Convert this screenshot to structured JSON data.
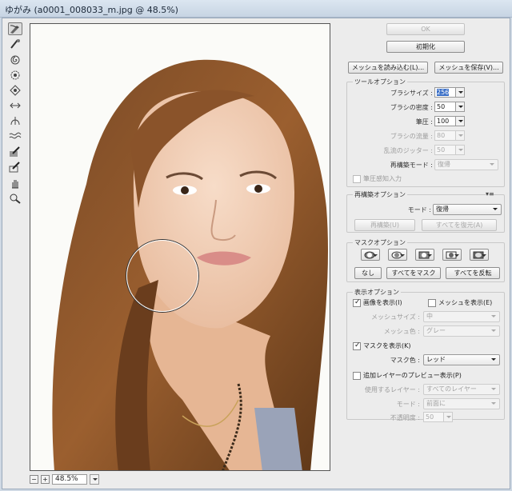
{
  "window": {
    "title": "ゆがみ (a0001_008033_m.jpg @ 48.5%)"
  },
  "status": {
    "zoom": "48.5%"
  },
  "buttons": {
    "ok": "OK",
    "reset": "初期化",
    "load_mesh": "メッシュを読み込む(L)...",
    "save_mesh": "メッシュを保存(V)..."
  },
  "tool_options": {
    "title": "ツールオプション",
    "brush_size_label": "ブラシサイズ :",
    "brush_size": "256",
    "brush_density_label": "ブラシの密度 :",
    "brush_density": "50",
    "brush_pressure_label": "筆圧 :",
    "brush_pressure": "100",
    "brush_rate_label": "ブラシの流量 :",
    "brush_rate": "80",
    "turbulent_jitter_label": "乱流のジッター :",
    "turbulent_jitter": "50",
    "reconstruct_mode_label": "再構築モード :",
    "reconstruct_mode": "復帰",
    "stylus_pressure": "筆圧感知入力"
  },
  "reconstruct_options": {
    "title": "再構築オプション",
    "mode_label": "モード :",
    "mode": "復帰",
    "reconstruct_button": "再構築(U)",
    "restore_all_button": "すべてを復元(A)"
  },
  "mask_options": {
    "title": "マスクオプション",
    "none_button": "なし",
    "mask_all_button": "すべてをマスク",
    "invert_all_button": "すべてを反転"
  },
  "view_options": {
    "title": "表示オプション",
    "show_image": "画像を表示(I)",
    "show_mesh": "メッシュを表示(E)",
    "mesh_size_label": "メッシュサイズ :",
    "mesh_size": "中",
    "mesh_color_label": "メッシュ色 :",
    "mesh_color": "グレー",
    "show_mask": "マスクを表示(K)",
    "mask_color_label": "マスク色 :",
    "mask_color": "レッド",
    "show_backdrop": "追加レイヤーのプレビュー表示(P)",
    "use_label": "使用するレイヤー :",
    "use": "すべてのレイヤー",
    "mode_label": "モード :",
    "mode": "前面に",
    "opacity_label": "不透明度 :",
    "opacity": "50"
  }
}
